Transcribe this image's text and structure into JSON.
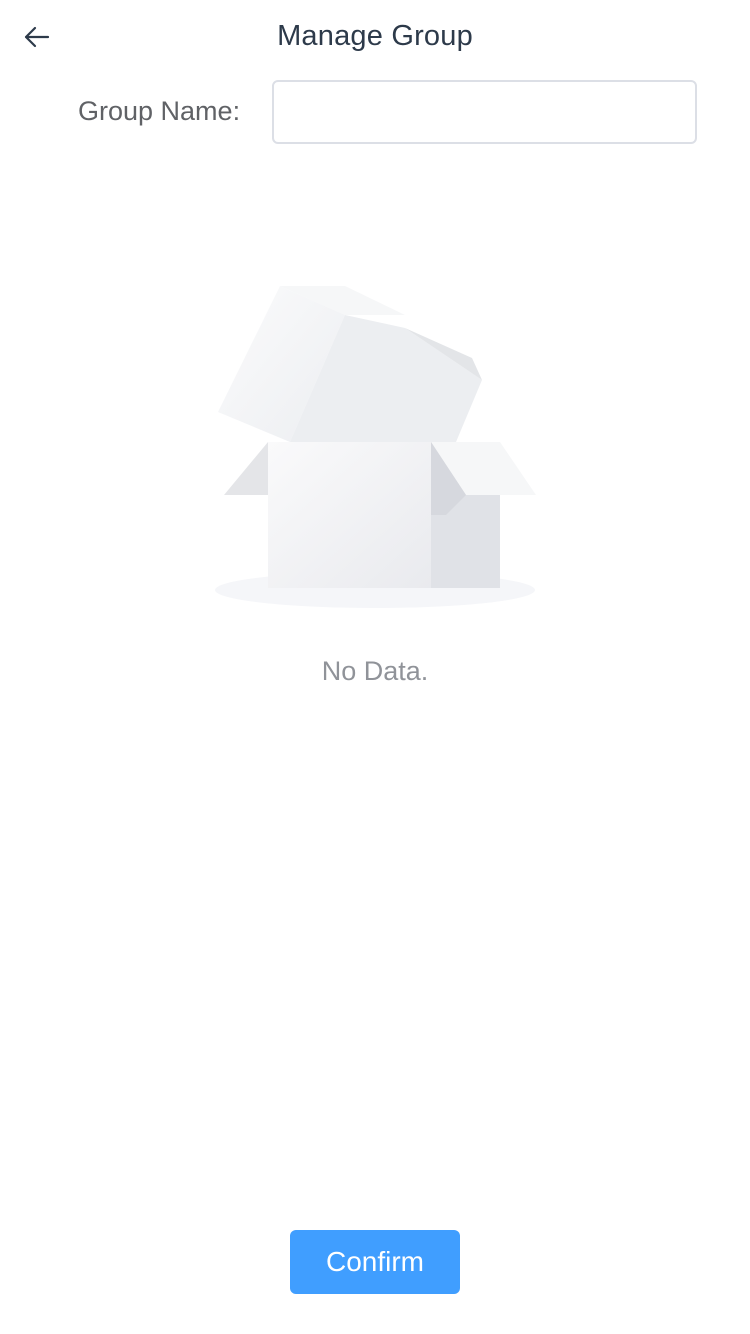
{
  "header": {
    "title": "Manage Group",
    "back_icon": "arrow-left-icon"
  },
  "form": {
    "group_name_label": "Group Name:",
    "group_name_value": "",
    "group_name_placeholder": ""
  },
  "empty_state": {
    "icon": "empty-box-icon",
    "text": "No Data."
  },
  "actions": {
    "confirm_label": "Confirm"
  },
  "colors": {
    "primary": "#409eff",
    "title_text": "#2d3a4a",
    "label_text": "#606266",
    "muted_text": "#909399",
    "input_border": "#dcdfe6"
  }
}
